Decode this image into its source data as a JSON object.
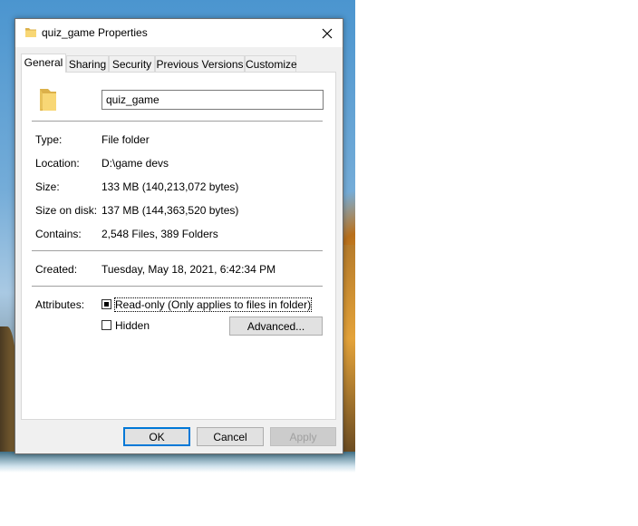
{
  "window": {
    "title": "quiz_game Properties"
  },
  "tabs": [
    {
      "label": "General"
    },
    {
      "label": "Sharing"
    },
    {
      "label": "Security"
    },
    {
      "label": "Previous Versions"
    },
    {
      "label": "Customize"
    }
  ],
  "general": {
    "name_value": "quiz_game",
    "type_label": "Type:",
    "type_value": "File folder",
    "location_label": "Location:",
    "location_value": "D:\\game devs",
    "size_label": "Size:",
    "size_value": "133 MB (140,213,072 bytes)",
    "size_on_disk_label": "Size on disk:",
    "size_on_disk_value": "137 MB (144,363,520 bytes)",
    "contains_label": "Contains:",
    "contains_value": "2,548 Files, 389 Folders",
    "created_label": "Created:",
    "created_value": "Tuesday, May 18, 2021, 6:42:34 PM",
    "attributes_label": "Attributes:",
    "readonly_label": "Read-only (Only applies to files in folder)",
    "hidden_label": "Hidden",
    "advanced_label": "Advanced..."
  },
  "buttons": {
    "ok": "OK",
    "cancel": "Cancel",
    "apply": "Apply"
  },
  "colors": {
    "accent": "#0078d7",
    "folder": "#f8d775"
  },
  "icons": {
    "folder": "folder-icon",
    "close": "close-icon"
  }
}
